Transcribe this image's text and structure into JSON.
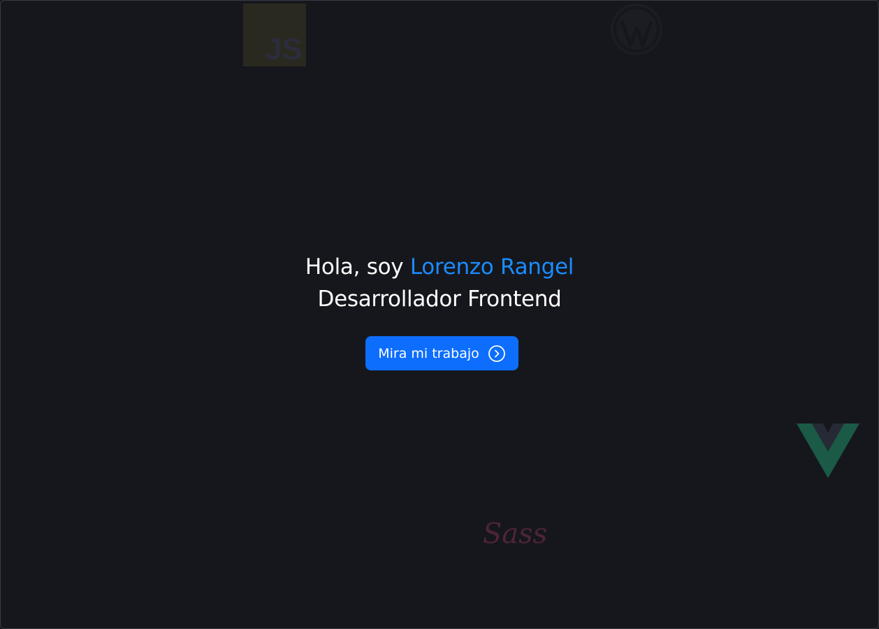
{
  "hero": {
    "greeting": "Hola, soy ",
    "name": "Lorenzo Rangel",
    "role": "Desarrollador Frontend"
  },
  "cta": {
    "label": "Mira mi trabajo",
    "icon": "chevron-right-circle-icon"
  },
  "logos": {
    "js": "JS",
    "sass": "Sass",
    "icons": [
      "javascript-logo-icon",
      "wordpress-logo-icon",
      "vue-logo-icon",
      "sass-logo-icon"
    ]
  },
  "colors": {
    "background": "#16171d",
    "accent": "#1a8cff",
    "button": "#0d6efd",
    "text": "#ffffff"
  }
}
